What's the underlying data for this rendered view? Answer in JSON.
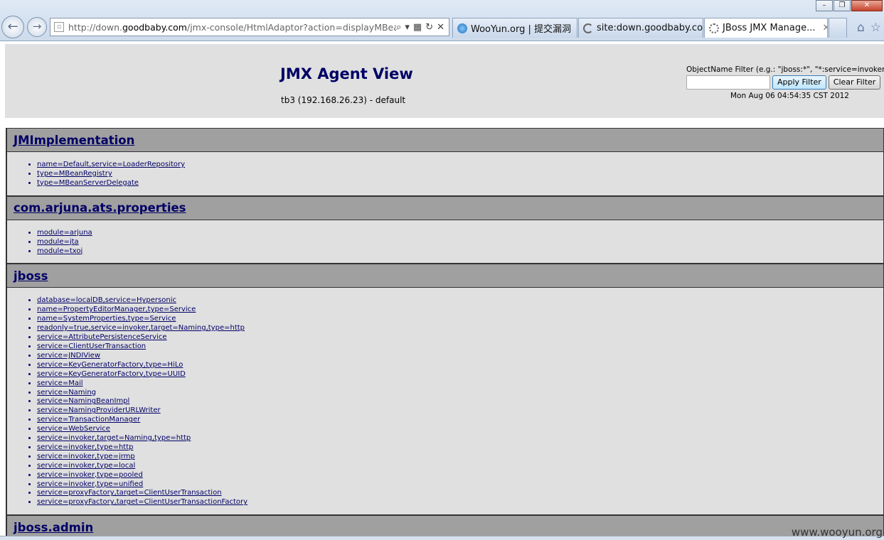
{
  "browser": {
    "url_prefix": "http://down.",
    "url_host": "goodbaby.com",
    "url_rest": "/jmx-console/HtmlAdaptor?action=displayMBeans",
    "tabs": [
      {
        "label": "WooYun.org | 提交漏洞",
        "icon": "ie-icon",
        "active": false
      },
      {
        "label": "site:down.goodbaby.co...",
        "icon": "loading-icon",
        "active": false
      },
      {
        "label": "JBoss JMX Manage...",
        "icon": "loading-icon",
        "active": true
      }
    ],
    "tab_close": "✕"
  },
  "header": {
    "title": "JMX Agent View",
    "host": "tb3 (192.168.26.23) - default",
    "filter_label": "ObjectName Filter (e.g.: \"jboss:*\", \"*:service=invoker,*\"):",
    "filter_value": "",
    "apply_label": "Apply Filter",
    "clear_label": "Clear Filter",
    "date": "Mon Aug 06 04:54:35 CST 2012"
  },
  "domains": [
    {
      "name": "JMImplementation",
      "mbeans": [
        "name=Default,service=LoaderRepository",
        "type=MBeanRegistry",
        "type=MBeanServerDelegate"
      ]
    },
    {
      "name": "com.arjuna.ats.properties",
      "mbeans": [
        "module=arjuna",
        "module=jta",
        "module=txoj"
      ]
    },
    {
      "name": "jboss",
      "mbeans": [
        "database=localDB,service=Hypersonic",
        "name=PropertyEditorManager,type=Service",
        "name=SystemProperties,type=Service",
        "readonly=true,service=invoker,target=Naming,type=http",
        "service=AttributePersistenceService",
        "service=ClientUserTransaction",
        "service=JNDIView",
        "service=KeyGeneratorFactory,type=HiLo",
        "service=KeyGeneratorFactory,type=UUID",
        "service=Mail",
        "service=Naming",
        "service=NamingBeanImpl",
        "service=NamingProviderURLWriter",
        "service=TransactionManager",
        "service=WebService",
        "service=invoker,target=Naming,type=http",
        "service=invoker,type=http",
        "service=invoker,type=jrmp",
        "service=invoker,type=local",
        "service=invoker,type=pooled",
        "service=invoker,type=unified",
        "service=proxyFactory,target=ClientUserTransaction",
        "service=proxyFactory,target=ClientUserTransactionFactory"
      ]
    },
    {
      "name": "jboss.admin",
      "mbeans": []
    }
  ],
  "watermark": "www.wooyun.org"
}
